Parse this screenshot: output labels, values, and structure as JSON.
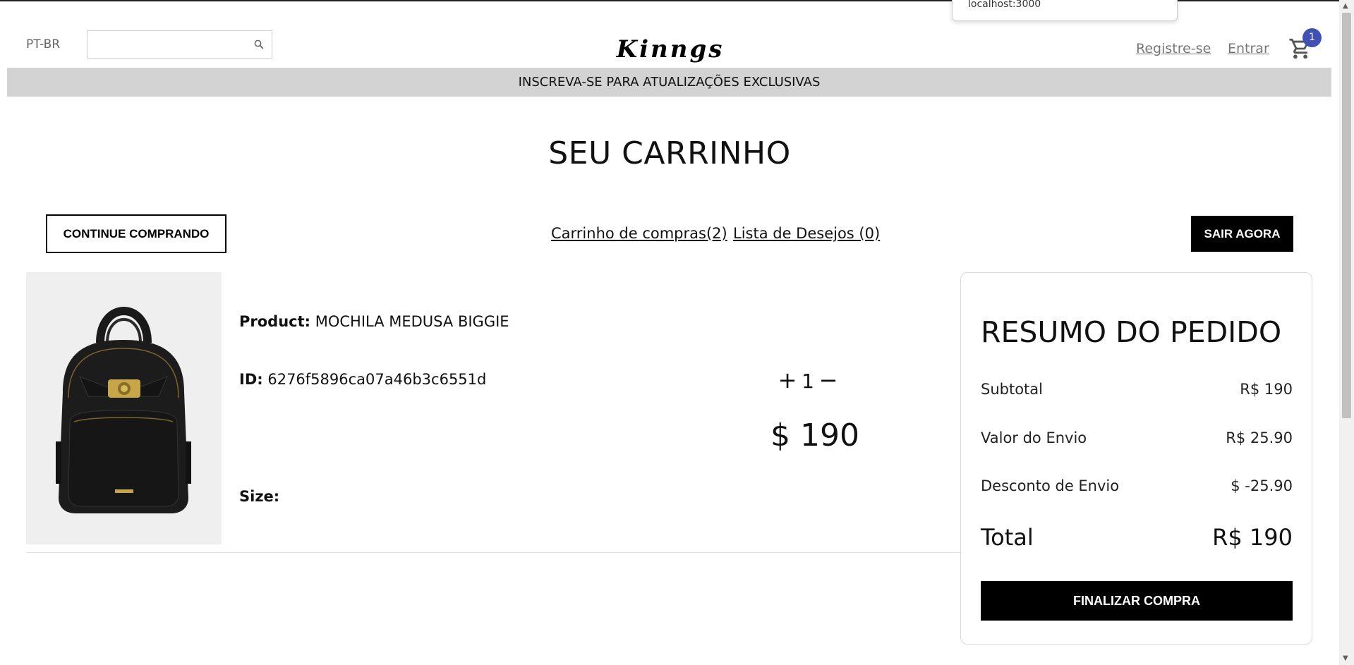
{
  "browser": {
    "url_tooltip": "localhost:3000"
  },
  "header": {
    "language": "PT-BR",
    "search": {
      "value": "",
      "placeholder": ""
    },
    "logo": "Kinngs",
    "register_link": "Registre-se",
    "login_link": "Entrar",
    "cart_count": "1"
  },
  "announcement": "INSCREVA-SE PARA ATUALIZAÇÕES EXCLUSIVAS",
  "page": {
    "title": "SEU CARRINHO",
    "continue_button": "CONTINUE COMPRANDO",
    "tabs": {
      "cart": "Carrinho de compras(2)",
      "wishlist": "Lista de Desejos (0)"
    },
    "checkout_now_button": "SAIR AGORA"
  },
  "item": {
    "product_label": "Product:",
    "product_name": "MOCHILA MEDUSA BIGGIE",
    "id_label": "ID:",
    "id_value": "6276f5896ca07a46b3c6551d",
    "size_label": "Size:",
    "size_value": "",
    "qty_plus": "+",
    "quantity": "1",
    "qty_minus": "−",
    "price": "$ 190"
  },
  "summary": {
    "title": "RESUMO DO PEDIDO",
    "subtotal_label": "Subtotal",
    "subtotal_value": "R$ 190",
    "shipping_label": "Valor do Envio",
    "shipping_value": "R$ 25.90",
    "discount_label": "Desconto de Envio",
    "discount_value": "$ -25.90",
    "total_label": "Total",
    "total_value": "R$ 190",
    "finalize_button": "FINALIZAR COMPRA"
  },
  "icons": [
    "search-icon",
    "cart-icon",
    "backpack-image",
    "scroll-up-arrow-icon",
    "scroll-down-arrow-icon"
  ],
  "colors": {
    "badge": "#3f51b5",
    "announcement_bg": "#d3d3d3",
    "primary_button": "#000000"
  }
}
